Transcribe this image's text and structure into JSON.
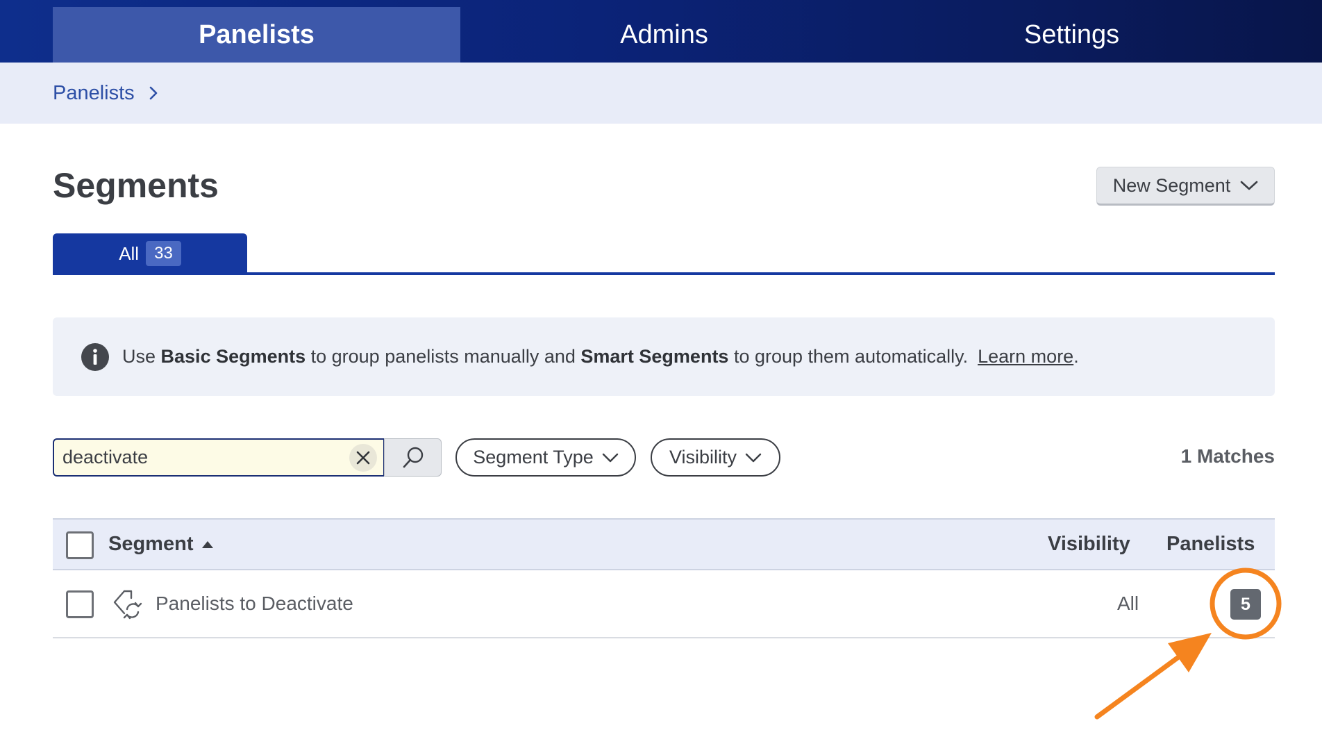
{
  "nav": {
    "tabs": [
      {
        "label": "Panelists",
        "active": true
      },
      {
        "label": "Admins",
        "active": false
      },
      {
        "label": "Settings",
        "active": false
      }
    ]
  },
  "breadcrumb": {
    "label": "Panelists"
  },
  "page": {
    "title": "Segments",
    "new_segment_label": "New Segment"
  },
  "tabs": {
    "all_label": "All",
    "all_count": "33"
  },
  "info": {
    "prefix": "Use ",
    "basic": "Basic Segments",
    "middle": " to group panelists manually and ",
    "smart": "Smart Segments",
    "suffix": " to group them automatically.",
    "learn_more": "Learn more",
    "period": "."
  },
  "search": {
    "value": "deactivate"
  },
  "filters": {
    "segment_type": "Segment Type",
    "visibility": "Visibility"
  },
  "matches": "1 Matches",
  "table": {
    "headers": {
      "segment": "Segment",
      "visibility": "Visibility",
      "panelists": "Panelists"
    },
    "rows": [
      {
        "name": "Panelists to Deactivate",
        "visibility": "All",
        "panelists": "5"
      }
    ]
  },
  "colors": {
    "nav_bg": "#0b2378",
    "nav_active": "#3d58aa",
    "accent": "#1538a0",
    "annotation": "#f5841f"
  }
}
